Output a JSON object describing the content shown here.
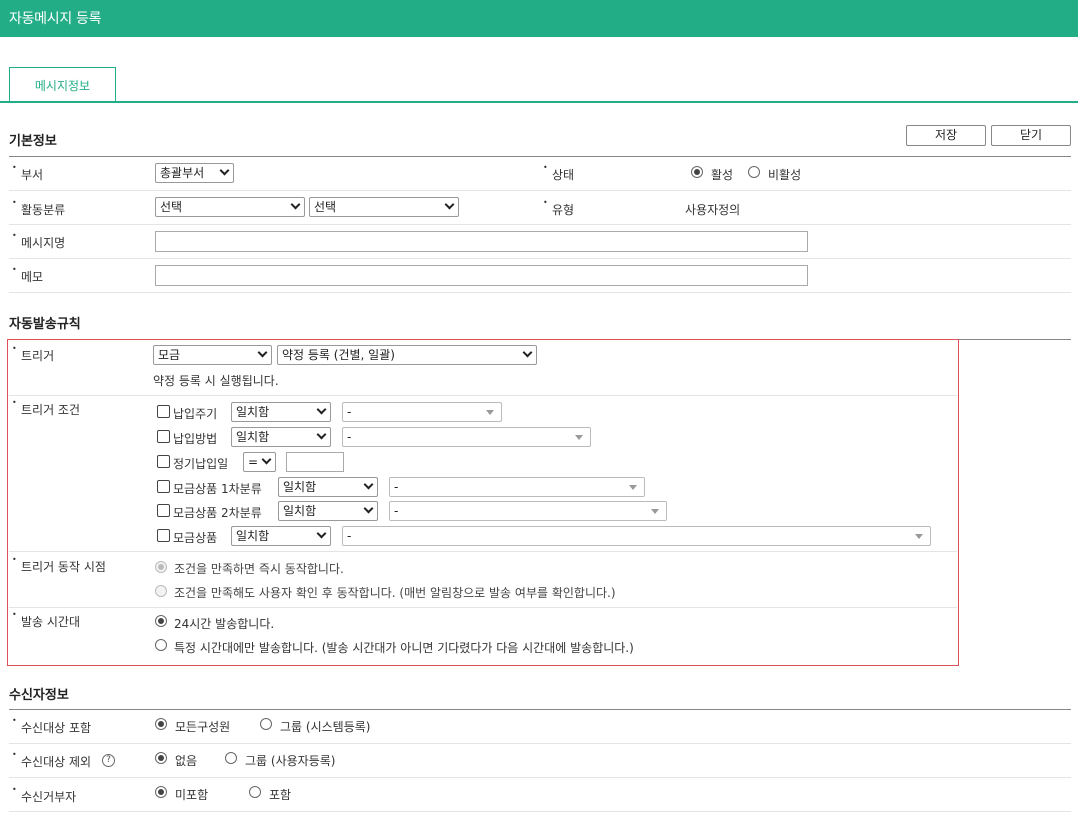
{
  "window": {
    "title": "자동메시지 등록"
  },
  "tabs": [
    {
      "label": "메시지정보"
    }
  ],
  "toolbar": {
    "save_label": "저장",
    "close_label": "닫기"
  },
  "basic": {
    "title": "기본정보",
    "dept_label": "부서",
    "dept_value": "총괄부서",
    "status_label": "상태",
    "status_active": "활성",
    "status_inactive": "비활성",
    "category_label": "활동분류",
    "category_1": "선택",
    "category_2": "선택",
    "type_label": "유형",
    "type_value": "사용자정의",
    "name_label": "메시지명",
    "name_value": "",
    "memo_label": "메모",
    "memo_value": ""
  },
  "rules": {
    "title": "자동발송규칙",
    "trigger_label": "트리거",
    "trigger_group": "모금",
    "trigger_event": "약정 등록 (건별, 일괄)",
    "trigger_desc": "약정 등록 시 실행됩니다.",
    "cond_label": "트리거 조건",
    "conditions": [
      {
        "label": "납입주기",
        "op": "일치함",
        "value": "-"
      },
      {
        "label": "납입방법",
        "op": "일치함",
        "value": "-"
      },
      {
        "label": "정기납입일",
        "op": "=",
        "value": ""
      },
      {
        "label": "모금상품 1차분류",
        "op": "일치함",
        "value": "-"
      },
      {
        "label": "모금상품 2차분류",
        "op": "일치함",
        "value": "-"
      },
      {
        "label": "모금상품",
        "op": "일치함",
        "value": "-"
      }
    ],
    "timing_label": "트리거 동작 시점",
    "timing_opt1": "조건을 만족하면 즉시 동작합니다.",
    "timing_opt2": "조건을 만족해도 사용자 확인 후 동작합니다. (매번 알림창으로 발송 여부를 확인합니다.)",
    "hours_label": "발송 시간대",
    "hours_opt1": "24시간 발송합니다.",
    "hours_opt2": "특정 시간대에만 발송합니다. (발송 시간대가 아니면 기다렸다가 다음 시간대에 발송합니다.)"
  },
  "recipients": {
    "title": "수신자정보",
    "include_label": "수신대상 포함",
    "include_opt1": "모든구성원",
    "include_opt2": "그룹 (시스템등록)",
    "exclude_label": "수신대상 제외",
    "exclude_opt1": "없음",
    "exclude_opt2": "그룹 (사용자등록)",
    "reject_label": "수신거부자",
    "reject_opt1": "미포함",
    "reject_opt2": "포함",
    "help_glyph": "?"
  },
  "colors": {
    "accent": "#23ad86",
    "highlight_border": "#e0505a"
  }
}
